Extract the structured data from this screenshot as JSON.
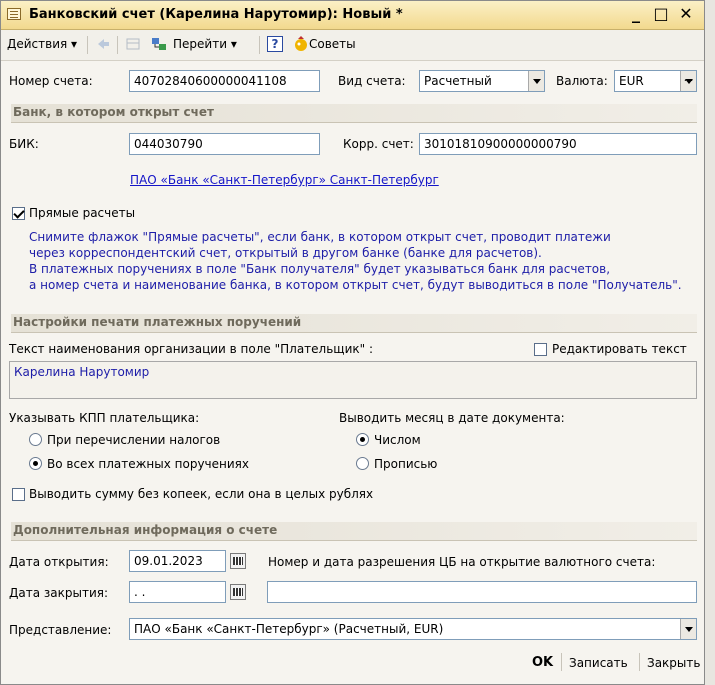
{
  "window": {
    "title": "Банковский счет (Карелина Нарутомир): Новый *",
    "minimize": "_",
    "maximize": "□",
    "close": "✕"
  },
  "toolbar": {
    "actions": "Действия",
    "goto": "Перейти",
    "help": "?",
    "tips": "Советы"
  },
  "account": {
    "number_label": "Номер счета:",
    "number": "40702840600000041108",
    "type_label": "Вид счета:",
    "type": "Расчетный",
    "currency_label": "Валюта:",
    "currency": "EUR",
    "ellipsis": "..."
  },
  "bank_section": {
    "title": "Банк, в котором открыт счет",
    "bik_label": "БИК:",
    "bik": "044030790",
    "corr_label": "Корр. счет:",
    "corr": "30101810900000000790",
    "bank_link": "ПАО «Банк «Санкт-Петербург» Санкт-Петербург"
  },
  "direct": {
    "label": "Прямые расчеты",
    "checked": true,
    "hint": [
      "Снимите флажок \"Прямые расчеты\", если банк, в котором открыт счет, проводит платежи",
      "через корреспондентский счет, открытый в другом банке (банке для расчетов).",
      "В платежных поручениях в поле \"Банк получателя\" будет указываться банк для расчетов,",
      "а номер счета и наименование банка, в котором открыт счет, будут выводиться в поле \"Получатель\"."
    ]
  },
  "print_section": {
    "title": "Настройки печати платежных поручений",
    "payer_text_label": "Текст наименования организации в поле \"Плательщик\" :",
    "edit_text_label": "Редактировать текст",
    "payer_text": "Карелина Нарутомир",
    "kpp_label": "Указывать КПП плательщика:",
    "kpp_taxes": "При перечислении налогов",
    "kpp_all": "Во всех платежных поручениях",
    "month_label": "Выводить месяц в дате документа:",
    "month_number": "Числом",
    "month_words": "Прописью",
    "no_kopecks": "Выводить сумму без копеек, если она в целых рублях"
  },
  "extra_section": {
    "title": "Дополнительная информация о счете",
    "open_date_label": "Дата открытия:",
    "open_date": "09.01.2023",
    "close_date_label": "Дата закрытия:",
    "close_date": " .  .",
    "permit_label": "Номер и дата разрешения ЦБ на открытие валютного счета:",
    "permit": "",
    "repr_label": "Представление:",
    "repr": "ПАО «Банк «Санкт-Петербург» (Расчетный, EUR)"
  },
  "buttons": {
    "ok": "OK",
    "save": "Записать",
    "close": "Закрыть"
  }
}
